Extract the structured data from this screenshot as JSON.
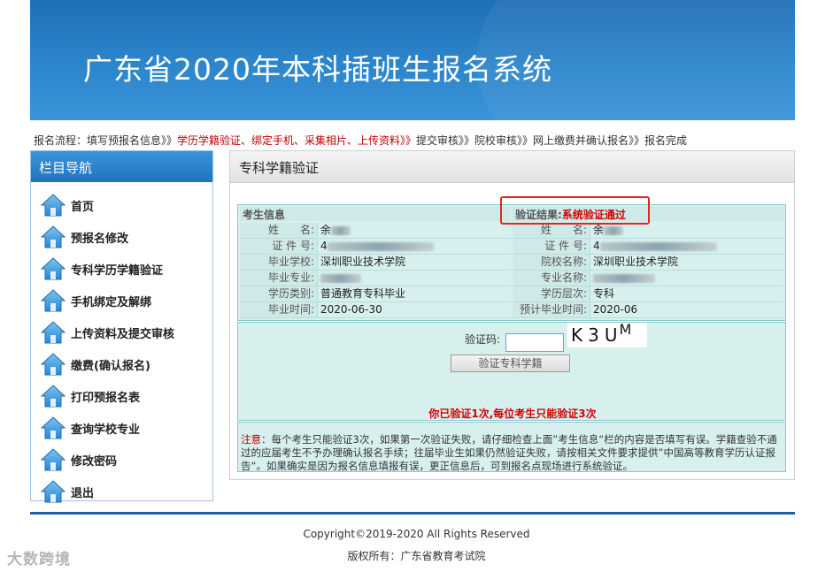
{
  "header": {
    "title": "广东省2020年本科插班生报名系统",
    "accent": "#2d86cc"
  },
  "flow": {
    "prefix": "报名流程：填写预报名信息》》",
    "current": "学历学籍验证、绑定手机、采集相片、上传资料》》",
    "suffix": "提交审核》》院校审核》》网上缴费并确认报名》》报名完成"
  },
  "sidebar": {
    "title": "栏目导航",
    "items": [
      {
        "label": "首页",
        "icon": "home-icon"
      },
      {
        "label": "预报名修改",
        "icon": "home-icon"
      },
      {
        "label": "专科学历学籍验证",
        "icon": "home-icon"
      },
      {
        "label": "手机绑定及解绑",
        "icon": "home-icon"
      },
      {
        "label": "上传资料及提交审核",
        "icon": "home-icon"
      },
      {
        "label": "缴费(确认报名)",
        "icon": "home-icon"
      },
      {
        "label": "打印预报名表",
        "icon": "home-icon"
      },
      {
        "label": "查询学校专业",
        "icon": "home-icon"
      },
      {
        "label": "修改密码",
        "icon": "home-icon"
      },
      {
        "label": "退出",
        "icon": "home-icon"
      }
    ]
  },
  "panel": {
    "title": "专科学籍验证",
    "left_header": "考生信息",
    "right_header_label": "验证结果:",
    "right_header_value": "系统验证通过",
    "left_rows": [
      {
        "key": "姓　　名:",
        "value": "余"
      },
      {
        "key": "证 件 号:",
        "value": "4"
      },
      {
        "key": "毕业学校:",
        "value": "深圳职业技术学院"
      },
      {
        "key": "毕业专业:",
        "value": ""
      },
      {
        "key": "学历类别:",
        "value": "普通教育专科毕业"
      },
      {
        "key": "毕业时间:",
        "value": "2020-06-30"
      }
    ],
    "right_rows": [
      {
        "key": "姓　　名:",
        "value": "余"
      },
      {
        "key": "证 件 号:",
        "value": "4"
      },
      {
        "key": "院校名称:",
        "value": "深圳职业技术学院"
      },
      {
        "key": "专业名称:",
        "value": ""
      },
      {
        "key": "学历层次:",
        "value": "专科"
      },
      {
        "key": "预计毕业时间:",
        "value": "2020-06"
      }
    ],
    "captcha_label": "验证码:",
    "captcha_value": "",
    "captcha_text": "K3U",
    "captcha_sup": "M",
    "verify_button": "验证专科学籍",
    "attempt_notice": "你已验证1次,每位考生只能验证3次",
    "note_lead": "注意：",
    "note_text": "每个考生只能验证3次，如果第一次验证失败，请仔细检查上面”考生信息“栏的内容是否填写有误。学籍查验不通过的应届考生不予办理确认报名手续；往届毕业生如果仍然验证失败，请按相关文件要求提供”中国高等教育学历认证报告“。如果确实是因为报名信息填报有误，更正信息后，可到报名点现场进行系统验证。"
  },
  "footer": {
    "copyright": "Copyright©2019-2020 All Rights Reserved",
    "owner": "版权所有：广东省教育考试院"
  },
  "watermark": "大数跨境"
}
